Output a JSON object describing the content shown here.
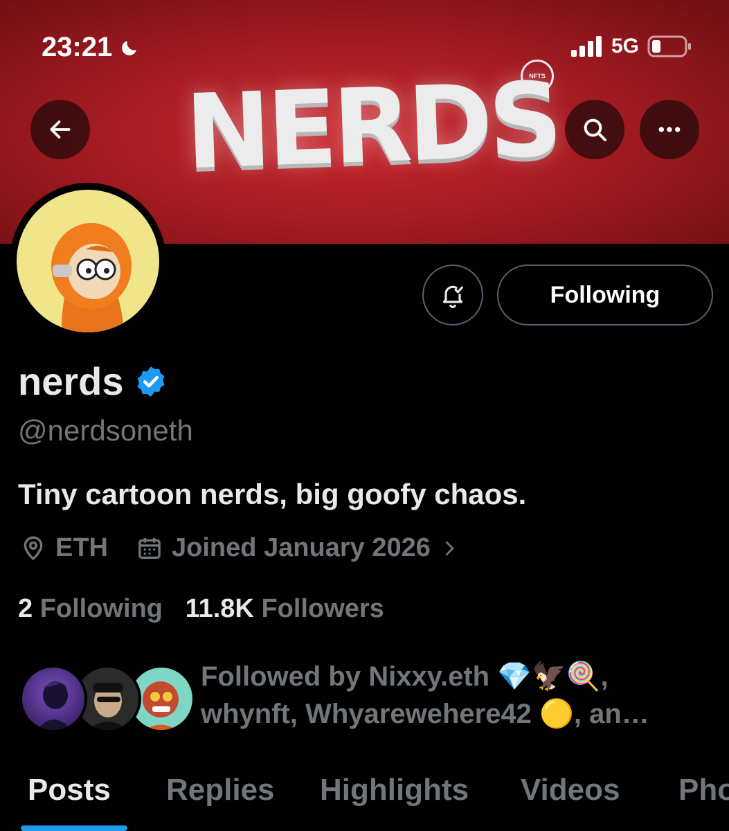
{
  "status_bar": {
    "time": "23:21",
    "network": "5G",
    "icons": [
      "moon-icon",
      "signal-icon",
      "battery-icon"
    ]
  },
  "banner": {
    "logo_text": "NERDS",
    "badge_text": "NFTS",
    "background_color": "#b5202a"
  },
  "header_buttons": {
    "back_icon": "arrow-left-icon",
    "search_icon": "search-icon",
    "more_icon": "more-dots-icon"
  },
  "actions": {
    "notify_icon": "bell-check-icon",
    "following_label": "Following"
  },
  "profile": {
    "name": "nerds",
    "verified": true,
    "handle": "@nerdsoneth",
    "bio": "Tiny cartoon nerds, big goofy chaos.",
    "location": "ETH",
    "joined": "Joined January 2026",
    "following_count": "2",
    "following_label": "Following",
    "followers_count": "11.8K",
    "followers_label": "Followers"
  },
  "followed_by": {
    "line1": "Followed by Nixxy.eth 💎🦅🍭,",
    "line2": "whynft, Whyarewehere42 🟡, an…"
  },
  "tabs": [
    {
      "label": "Posts",
      "active": true
    },
    {
      "label": "Replies",
      "active": false
    },
    {
      "label": "Highlights",
      "active": false
    },
    {
      "label": "Videos",
      "active": false
    },
    {
      "label": "Pho",
      "active": false
    }
  ],
  "colors": {
    "accent": "#1d9bf0",
    "muted_text": "#71767b",
    "primary_text": "#e7e9ea"
  }
}
